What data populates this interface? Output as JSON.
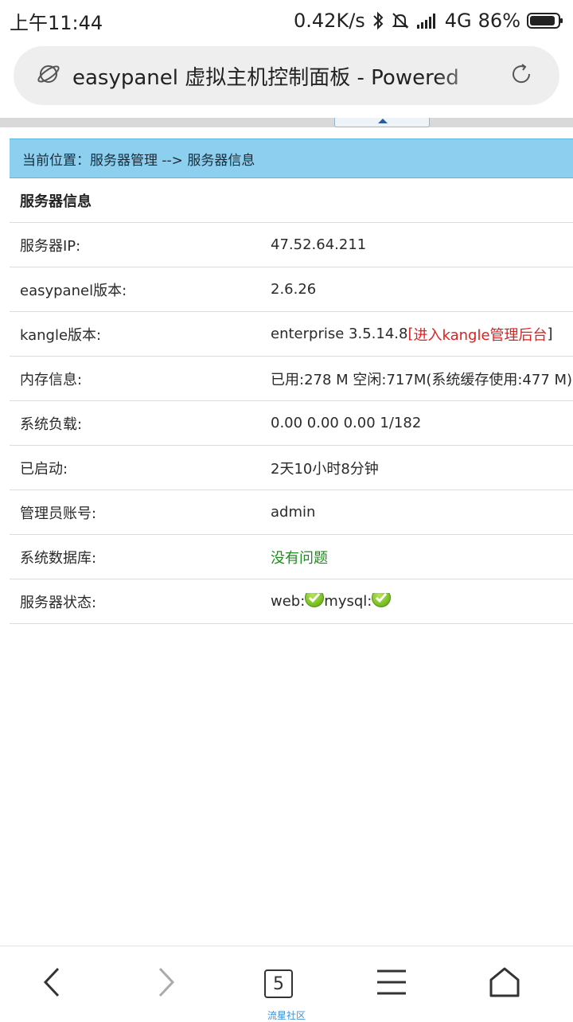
{
  "status_bar": {
    "time": "上午11:44",
    "net_speed": "0.42K/s",
    "network": "4G",
    "battery": "86%"
  },
  "browser": {
    "page_title": "easypanel 虚拟主机控制面板 - Powered",
    "tab_count": "5",
    "bottom_caption": "流星社区"
  },
  "breadcrumb": {
    "text": "当前位置：服务器管理 --> 服务器信息"
  },
  "server_info": {
    "header": "服务器信息",
    "rows": [
      {
        "label": "服务器IP:",
        "value": "47.52.64.211"
      },
      {
        "label": "easypanel版本:",
        "value": "2.6.26"
      },
      {
        "label": "kangle版本:",
        "value": "enterprise 3.5.14.8",
        "link_open": "[",
        "link_text": "进入kangle管理后台",
        "link_close": "]"
      },
      {
        "label": "内存信息:",
        "value": "已用:278 M 空闲:717M(系统缓存使用:477 M)"
      },
      {
        "label": "系统负载:",
        "value": "0.00 0.00 0.00 1/182"
      },
      {
        "label": "已启动:",
        "value": "2天10小时8分钟"
      },
      {
        "label": "管理员账号:",
        "value": "admin"
      },
      {
        "label": "系统数据库:",
        "value": "没有问题"
      },
      {
        "label": "服务器状态:",
        "web_label": "web:",
        "mysql_label": "mysql:"
      }
    ]
  },
  "colors": {
    "breadcrumb_bg": "#8ccfee",
    "link_red": "#e02020",
    "ok_green": "#1f8a1f",
    "caption_blue": "#3a8fd6"
  },
  "icons": {
    "address_left": "planet-icon",
    "reload": "reload-icon",
    "nav": [
      "back-icon",
      "forward-icon",
      "tabs-icon",
      "menu-icon",
      "home-icon"
    ]
  }
}
